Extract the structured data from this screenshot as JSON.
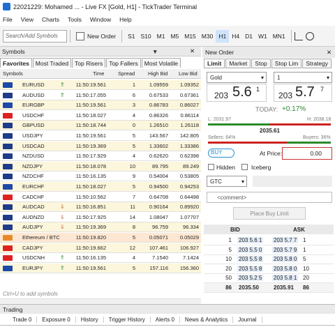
{
  "title": "22021229: Mohamed ... - Live FX [Gold, H1] - TickTrader Terminal",
  "menu": [
    "File",
    "View",
    "Charts",
    "Tools",
    "Window",
    "Help"
  ],
  "toolbar": {
    "search_placeholder": "Search/Add Symbols",
    "new_order": "New Order",
    "timeframes": [
      "S1",
      "S10",
      "M1",
      "M5",
      "M15",
      "M30",
      "H1",
      "H4",
      "D1",
      "W1",
      "MN1"
    ],
    "active_tf": "H1"
  },
  "symbols": {
    "header": "Symbols",
    "tabs": [
      "Favorites",
      "Most Traded",
      "Top Risers",
      "Top Fallers",
      "Most Volatile"
    ],
    "columns": [
      "Symbols",
      "Time",
      "Spread",
      "High Bid",
      "Low Bid"
    ],
    "rows": [
      {
        "sym": "EURUSD",
        "dir": "up",
        "time": "11:50:19.561",
        "spread": "1",
        "hb": "1.09559",
        "lb": "1.09352"
      },
      {
        "sym": "AUDUSD",
        "dir": "up",
        "time": "11:50:17.055",
        "spread": "6",
        "hb": "0.67533",
        "lb": "0.67361"
      },
      {
        "sym": "EURGBP",
        "dir": "",
        "time": "11:50:19.561",
        "spread": "3",
        "hb": "0.86783",
        "lb": "0.86027"
      },
      {
        "sym": "USDCHF",
        "dir": "",
        "time": "11:50:18.027",
        "spread": "4",
        "hb": "0.86326",
        "lb": "0.86114"
      },
      {
        "sym": "GBPUSD",
        "dir": "",
        "time": "11:50:18.744",
        "spread": "0",
        "hb": "1.26510",
        "lb": "1.26118"
      },
      {
        "sym": "USDJPY",
        "dir": "",
        "time": "11:50:19.561",
        "spread": "5",
        "hb": "143.567",
        "lb": "142.805"
      },
      {
        "sym": "USDCAD",
        "dir": "",
        "time": "11:50:19.369",
        "spread": "5",
        "hb": "1.33602",
        "lb": "1.33386"
      },
      {
        "sym": "NZDUSD",
        "dir": "",
        "time": "11:50:17.929",
        "spread": "4",
        "hb": "0.62620",
        "lb": "0.62398"
      },
      {
        "sym": "NZDJPY",
        "dir": "",
        "time": "11:50:18.078",
        "spread": "10",
        "hb": "89.795",
        "lb": "89.249"
      },
      {
        "sym": "NZDCHF",
        "dir": "",
        "time": "11:50:16.135",
        "spread": "9",
        "hb": "0.54004",
        "lb": "0.53805"
      },
      {
        "sym": "EURCHF",
        "dir": "",
        "time": "11:50:18.027",
        "spread": "5",
        "hb": "0.94500",
        "lb": "0.94253"
      },
      {
        "sym": "CADCHF",
        "dir": "",
        "time": "11:50:10.562",
        "spread": "7",
        "hb": "0.64708",
        "lb": "0.64498"
      },
      {
        "sym": "AUDCAD",
        "dir": "down",
        "time": "11:50:16.851",
        "spread": "11",
        "hb": "0.90164",
        "lb": "0.89920"
      },
      {
        "sym": "AUDNZD",
        "dir": "down",
        "time": "11:50:17.925",
        "spread": "14",
        "hb": "1.08047",
        "lb": "1.07707"
      },
      {
        "sym": "AUDJPY",
        "dir": "down",
        "time": "11:50:19.369",
        "spread": "8",
        "hb": "96.759",
        "lb": "96.334"
      },
      {
        "sym": "Ethereum / BTC",
        "dir": "",
        "time": "11:50:19.820",
        "spread": "5",
        "hb": "0.05071",
        "lb": "0.05029"
      },
      {
        "sym": "CADJPY",
        "dir": "",
        "time": "11:50:19.662",
        "spread": "12",
        "hb": "107.461",
        "lb": "106.927"
      },
      {
        "sym": "USDCNH",
        "dir": "up",
        "time": "11:50:16.135",
        "spread": "4",
        "hb": "7.1540",
        "lb": "7.1424"
      },
      {
        "sym": "EURJPY",
        "dir": "up",
        "time": "11:50:19.561",
        "spread": "5",
        "hb": "157.116",
        "lb": "156.360"
      }
    ],
    "add_hint": "Ctrl+U to add symbols"
  },
  "new_order": {
    "header": "New Order",
    "tabs": [
      "Limit",
      "Market",
      "Stop",
      "Stop Lim",
      "Strategy"
    ],
    "symbol": "Gold",
    "volume": "1",
    "bid_pre": "203",
    "bid_big": "5.6",
    "bid_sup": "1",
    "ask_pre": "203",
    "ask_big": "5.7",
    "ask_sup": "7",
    "today_label": "TODAY:",
    "today_change": "+0.17%",
    "low": "L: 2031.97",
    "high": "H: 2038.18",
    "mid": "2035.61",
    "sellers": "Sellers: 64%",
    "buyers": "Buyers: 36%",
    "buy_toggle": "BUY",
    "at_price_label": "At Price:",
    "at_price": "0.00",
    "hidden": "Hidden",
    "iceberg": "Iceberg",
    "tif": "GTC",
    "comment": "<comment>",
    "place_btn": "Place Buy Limit"
  },
  "depth": {
    "cols": [
      "BID",
      "ASK"
    ],
    "rows": [
      [
        "1",
        "203 5.6 1",
        "203 5.7 7",
        "1"
      ],
      [
        "5",
        "203 5.5 0",
        "203 5.7 9",
        "1"
      ],
      [
        "10",
        "203 5.5 8",
        "203 5.8 0",
        "5"
      ],
      [
        "20",
        "203 5.5 8",
        "203 5.8 0",
        "10"
      ],
      [
        "50",
        "203 5.2 5",
        "203 5.8 1",
        "20"
      ]
    ],
    "total": [
      "86",
      "2035.50",
      "2035.91",
      "86"
    ]
  },
  "trading": {
    "header": "Trading",
    "tabs": [
      "Trade 0",
      "Exposure 0",
      "History",
      "Trigger History",
      "Alerts 0",
      "News & Analytics",
      "Journal"
    ]
  }
}
